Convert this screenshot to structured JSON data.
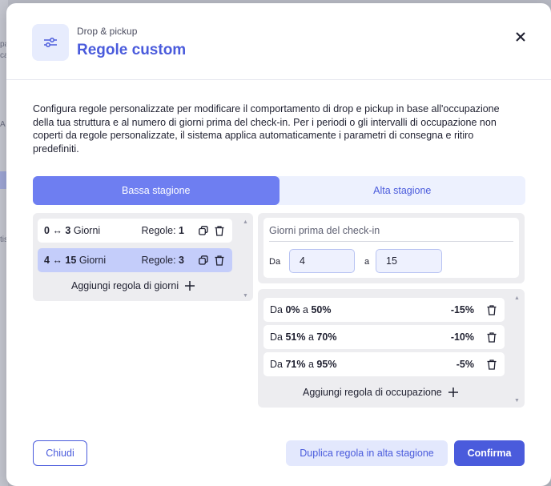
{
  "background": {
    "fragments": [
      "pa",
      "ca",
      "A",
      "tis"
    ]
  },
  "header": {
    "subtitle": "Drop & pickup",
    "title": "Regole custom",
    "icon": "sliders-icon",
    "close_icon": "close-icon"
  },
  "description": "Configura regole personalizzate per modificare il comportamento di drop e pickup in base all'occupazione della tua struttura e al numero di giorni prima del check-in. Per i periodi o gli intervalli di occupazione non coperti da regole personalizzate, il sistema applica automaticamente i parametri di consegna e ritiro predefiniti.",
  "tabs": [
    {
      "label": "Bassa stagione",
      "active": true
    },
    {
      "label": "Alta stagione",
      "active": false
    }
  ],
  "day_rules": [
    {
      "from": "0",
      "arrow": "↔",
      "to": "3",
      "unit": "Giorni",
      "rules_label": "Regole:",
      "rules_count": "1",
      "selected": false
    },
    {
      "from": "4",
      "arrow": "↔",
      "to": "15",
      "unit": "Giorni",
      "rules_label": "Regole:",
      "rules_count": "3",
      "selected": true
    }
  ],
  "add_day_rule": "Aggiungi regola di giorni",
  "checkin": {
    "label": "Giorni prima del check-in",
    "from_label": "Da",
    "from_value": "4",
    "to_label": "a",
    "to_value": "15"
  },
  "occupancy_rules": [
    {
      "prefix": "Da",
      "from": "0%",
      "sep": "a",
      "to": "50%",
      "value": "-15%"
    },
    {
      "prefix": "Da",
      "from": "51%",
      "sep": "a",
      "to": "70%",
      "value": "-10%"
    },
    {
      "prefix": "Da",
      "from": "71%",
      "sep": "a",
      "to": "95%",
      "value": "-5%"
    }
  ],
  "add_occupancy_rule": "Aggiungi regola di occupazione",
  "footer": {
    "close_label": "Chiudi",
    "duplicate_label": "Duplica regola in alta stagione",
    "confirm_label": "Confirma"
  },
  "colors": {
    "accent": "#4a5bdc",
    "tab_active": "#6e7ef1",
    "selected_row": "#c4cdfa",
    "panel_bg": "#ededf0"
  }
}
